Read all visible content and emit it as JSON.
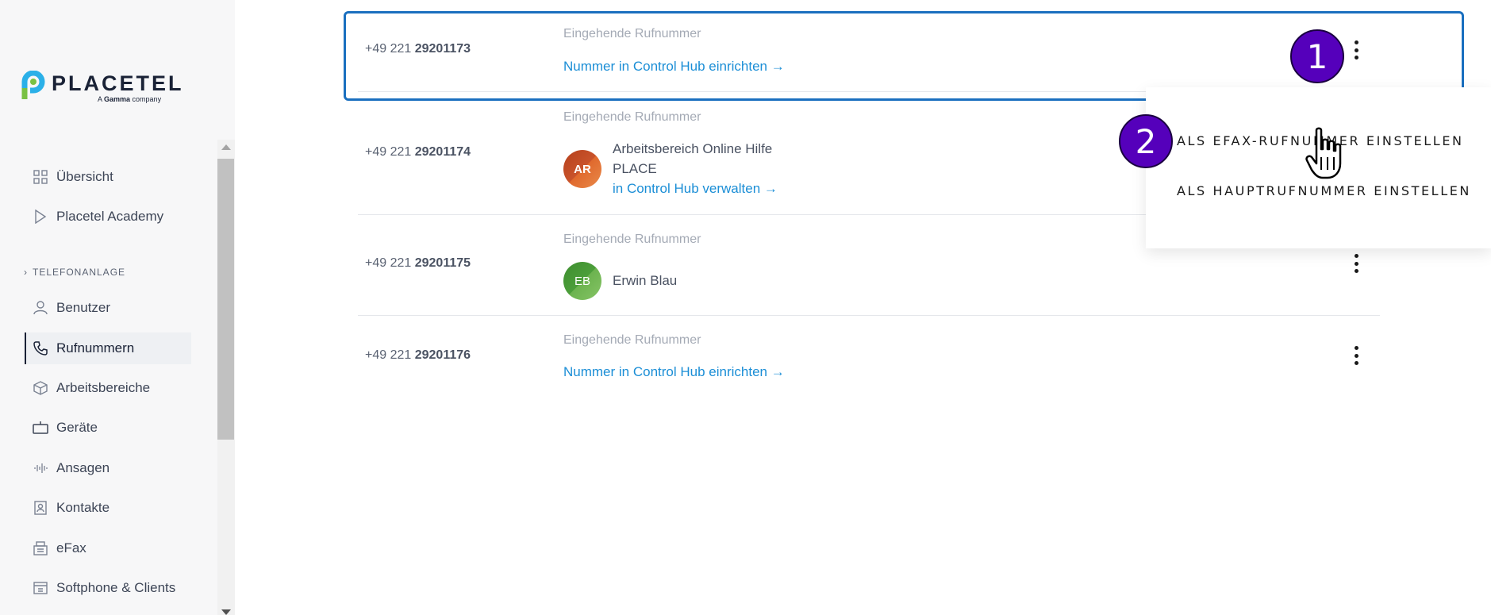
{
  "brand": {
    "name": "PLACETEL",
    "tagline_prefix": "A ",
    "tagline_brand": "Gamma",
    "tagline_suffix": " company",
    "accent": "#1b8ed6"
  },
  "sidebar": {
    "items_top": [
      {
        "label": "Übersicht",
        "icon": "grid-icon"
      },
      {
        "label": "Placetel Academy",
        "icon": "play-icon"
      }
    ],
    "section_title": "TELEFONANLAGE",
    "items": [
      {
        "label": "Benutzer",
        "icon": "user-icon"
      },
      {
        "label": "Rufnummern",
        "icon": "phone-icon",
        "active": true
      },
      {
        "label": "Arbeitsbereiche",
        "icon": "cube-icon"
      },
      {
        "label": "Geräte",
        "icon": "device-icon"
      },
      {
        "label": "Ansagen",
        "icon": "audio-wave-icon"
      },
      {
        "label": "Kontakte",
        "icon": "contact-card-icon"
      },
      {
        "label": "eFax",
        "icon": "fax-icon"
      },
      {
        "label": "Softphone & Clients",
        "icon": "window-icon"
      }
    ]
  },
  "numbers": [
    {
      "prefix": "+49 221 ",
      "number": "29201173",
      "label": "Eingehende Rufnummer",
      "link": "Nummer in Control Hub einrichten →"
    },
    {
      "prefix": "+49 221 ",
      "number": "29201174",
      "label": "Eingehende Rufnummer",
      "avatar": "AR",
      "entity_line1": "Arbeitsbereich Online Hilfe",
      "entity_line2": "PLACE",
      "link": "in Control Hub verwalten →"
    },
    {
      "prefix": "+49 221 ",
      "number": "29201175",
      "label": "Eingehende Rufnummer",
      "avatar": "EB",
      "entity_line1": "Erwin Blau"
    },
    {
      "prefix": "+49 221 ",
      "number": "29201176",
      "label": "Eingehende Rufnummer",
      "link": "Nummer in Control Hub einrichten →"
    }
  ],
  "dropdown": {
    "items": [
      "ALS EFAX-RUFNUMMER EINSTELLEN",
      "ALS HAUPTRUFNUMMER EINSTELLEN"
    ]
  },
  "annotations": {
    "step1": "1",
    "step2": "2",
    "badge_color": "#5500bb",
    "highlight_color": "#1a6fbf"
  }
}
